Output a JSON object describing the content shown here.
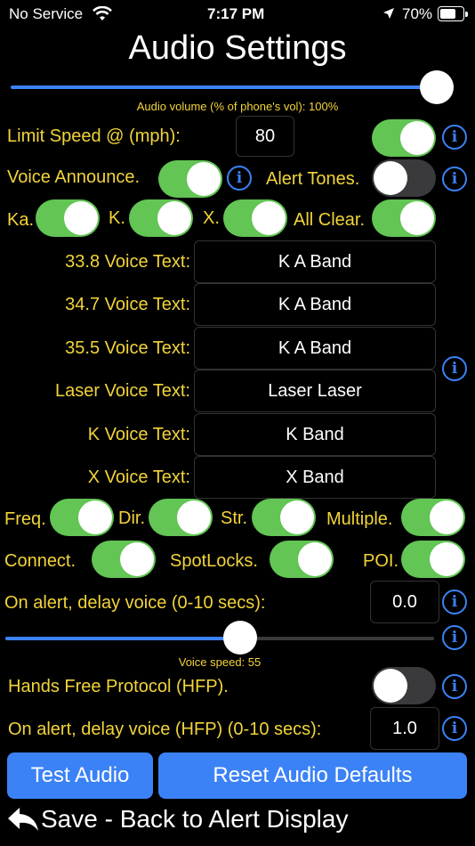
{
  "status_bar": {
    "carrier": "No Service",
    "time": "7:17 PM",
    "battery": "70%"
  },
  "title": "Audio Settings",
  "volume": {
    "caption": "Audio volume (% of phone's vol): 100%",
    "value": 1.0
  },
  "limit_speed": {
    "label": "Limit Speed @ (mph):",
    "value": "80",
    "toggle": true
  },
  "voice_announce": {
    "label": "Voice Announce.",
    "on": true
  },
  "alert_tones": {
    "label": "Alert Tones.",
    "on": false
  },
  "bands": {
    "ka": {
      "label": "Ka.",
      "on": true
    },
    "k": {
      "label": "K.",
      "on": true
    },
    "x": {
      "label": "X.",
      "on": true
    },
    "all_clear": {
      "label": "All Clear.",
      "on": true
    }
  },
  "voice_texts": [
    {
      "label": "33.8 Voice Text:",
      "value": "K A Band"
    },
    {
      "label": "34.7 Voice Text:",
      "value": "K A Band"
    },
    {
      "label": "35.5 Voice Text:",
      "value": "K A Band"
    },
    {
      "label": "Laser Voice Text:",
      "value": "Laser Laser"
    },
    {
      "label": "K Voice Text:",
      "value": "K Band"
    },
    {
      "label": "X Voice Text:",
      "value": "X Band"
    }
  ],
  "options_row1": {
    "freq": {
      "label": "Freq.",
      "on": true
    },
    "dir": {
      "label": "Dir.",
      "on": true
    },
    "str": {
      "label": "Str.",
      "on": true
    },
    "multiple": {
      "label": "Multiple.",
      "on": true
    }
  },
  "options_row2": {
    "connect": {
      "label": "Connect.",
      "on": true
    },
    "spotlocks": {
      "label": "SpotLocks.",
      "on": true
    },
    "poi": {
      "label": "POI.",
      "on": true
    }
  },
  "delay_voice": {
    "label": "On alert, delay voice (0-10 secs):",
    "value": "0.0"
  },
  "voice_speed": {
    "caption": "Voice speed: 55",
    "value": 55
  },
  "hfp": {
    "label": "Hands Free Protocol (HFP).",
    "on": false
  },
  "delay_voice_hfp": {
    "label": "On alert, delay voice (HFP) (0-10 secs):",
    "value": "1.0"
  },
  "buttons": {
    "test_audio": "Test Audio",
    "reset_defaults": "Reset Audio Defaults"
  },
  "save_back": "Save - Back to Alert Display",
  "colors": {
    "accent_blue": "#3b82f6",
    "toggle_green": "#62c554",
    "label_yellow": "#f2d43a"
  },
  "info_glyph": "i"
}
